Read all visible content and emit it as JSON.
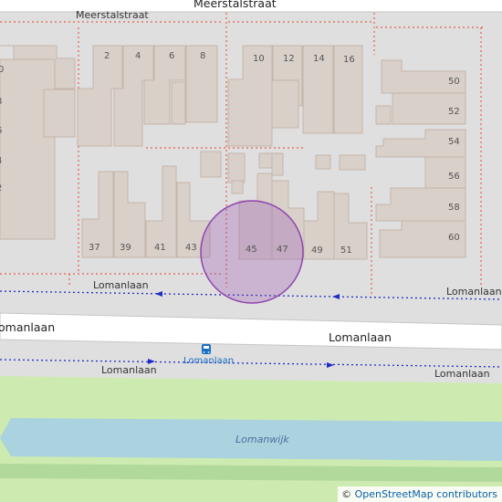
{
  "map": {
    "streets": {
      "meerstalstraat_top": "Meerstalstraat",
      "meerstalstraat_left": "Meerstalstraat",
      "lomanlaan_footpath_left": "Lomanlaan",
      "lomanlaan_footpath_right": "Lomanlaan",
      "lomanlaan_main_left": "omanlaan",
      "lomanlaan_main_right": "Lomanlaan",
      "lomanlaan_lower_left": "Lomanlaan",
      "lomanlaan_lower_right": "Lomanlaan"
    },
    "bus_stop": {
      "icon": "bus-stop-icon",
      "name": "Lomanlaan"
    },
    "water": {
      "name": "Lomanwijk"
    },
    "house_numbers": {
      "top_row": [
        "2",
        "4",
        "6",
        "8",
        "10",
        "12",
        "14",
        "16"
      ],
      "bottom_row": [
        "37",
        "39",
        "41",
        "43",
        "45",
        "47",
        "49",
        "51"
      ],
      "right_column": [
        "50",
        "52",
        "54",
        "56",
        "58",
        "60"
      ],
      "left_edge": [
        "0",
        "8",
        "6",
        "4",
        "2"
      ]
    },
    "highlight": {
      "type": "circle",
      "color": "#9b59b6"
    },
    "colors": {
      "background": "#e0dfdf",
      "building": "#d9d0c9",
      "building_outline": "#c4b6ab",
      "grass": "#cdebb0",
      "water": "#aad3df",
      "road": "#ffffff",
      "path": "#1f2bc6",
      "boundary": "#e0614f"
    },
    "attribution": {
      "symbol": "©",
      "text": "OpenStreetMap contributors"
    }
  }
}
